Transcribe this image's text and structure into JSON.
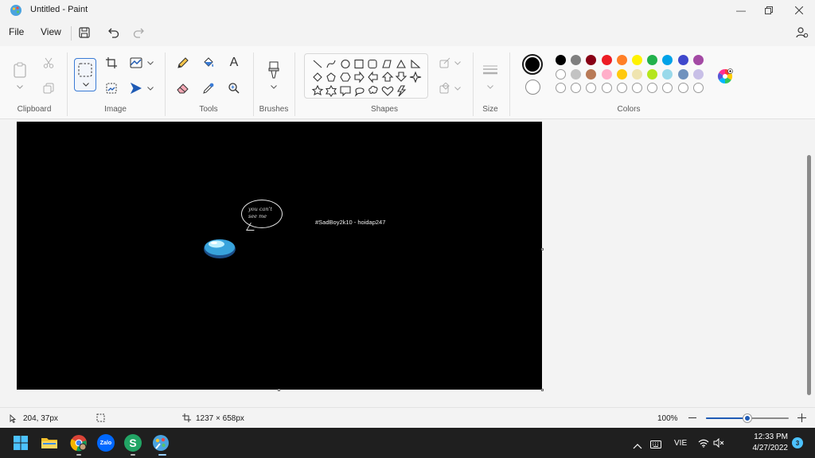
{
  "window": {
    "title": "Untitled - Paint",
    "minimize_icon": "minimize-icon",
    "restore_icon": "restore-icon",
    "close_icon": "close-icon"
  },
  "menu": {
    "file_label": "File",
    "view_label": "View"
  },
  "ribbon": {
    "groups": {
      "clipboard": "Clipboard",
      "image": "Image",
      "tools": "Tools",
      "brushes": "Brushes",
      "shapes": "Shapes",
      "size": "Size",
      "colors": "Colors"
    },
    "primary_color": "#000000",
    "secondary_color": "#ffffff",
    "palette_row1": [
      "#000000",
      "#7f7f7f",
      "#880015",
      "#ed1c24",
      "#ff7f27",
      "#fff200",
      "#22b14c",
      "#00a2e8",
      "#3f48cc",
      "#a349a4"
    ],
    "palette_row2": [
      "#ffffff",
      "#c3c3c3",
      "#b97a57",
      "#ffaec9",
      "#ffc90e",
      "#efe4b0",
      "#b5e61d",
      "#99d9ea",
      "#7092be",
      "#c8bfe7"
    ],
    "palette_row3_count": 10
  },
  "canvas": {
    "bubble_text": "you can't see me",
    "credit_text": "#SadBoy2k10 - hoidap247",
    "crewmate_color": "#38a3dc"
  },
  "status": {
    "cursor_position": "204, 37px",
    "canvas_size": "1237 × 658px",
    "zoom": "100%",
    "zoom_fraction": 0.5
  },
  "taskbar": {
    "apps": [
      "start-icon",
      "file-explorer-icon",
      "chrome-icon",
      "zalo-icon",
      "skype-icon",
      "paint-icon"
    ],
    "zalo_label": "Zalo",
    "skype_label": "S",
    "language": "VIE",
    "time": "12:33 PM",
    "date": "4/27/2022",
    "notification_count": "3"
  }
}
